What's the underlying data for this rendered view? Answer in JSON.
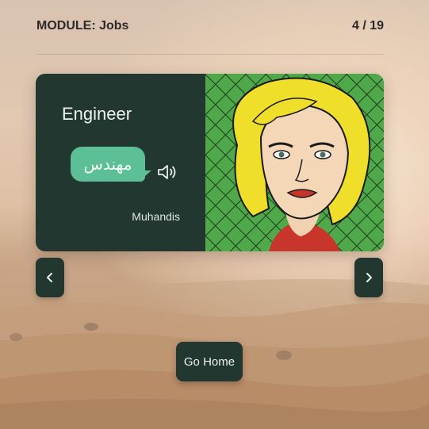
{
  "header": {
    "module_label": "MODULE: Jobs",
    "progress": "4 / 19"
  },
  "card": {
    "word": "Engineer",
    "translation": "مهندس",
    "transliteration": "Muhandis",
    "audio_icon": "speaker-icon",
    "image": "pop-art-woman-portrait"
  },
  "nav": {
    "prev_icon": "chevron-left-icon",
    "next_icon": "chevron-right-icon"
  },
  "footer": {
    "home_label": "Go Home"
  },
  "colors": {
    "card_bg": "#213730",
    "bubble": "#5dbf95",
    "accent_green": "#4fa84a"
  }
}
